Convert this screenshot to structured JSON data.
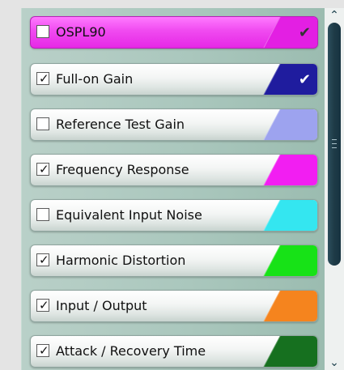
{
  "test_list": {
    "items": [
      {
        "label": "OSPL90",
        "checked": false,
        "selected": true,
        "color": "#e31fe3",
        "swatch_check": true
      },
      {
        "label": "Full-on Gain",
        "checked": true,
        "selected": false,
        "color": "#1f1c9e",
        "swatch_check": true
      },
      {
        "label": "Reference Test Gain",
        "checked": false,
        "selected": false,
        "color": "#9da3ef",
        "swatch_check": false
      },
      {
        "label": "Frequency Response",
        "checked": true,
        "selected": false,
        "color": "#f21ef2",
        "swatch_check": false
      },
      {
        "label": "Equivalent Input Noise",
        "checked": false,
        "selected": false,
        "color": "#34e6f0",
        "swatch_check": false
      },
      {
        "label": "Harmonic Distortion",
        "checked": true,
        "selected": false,
        "color": "#17e217",
        "swatch_check": false
      },
      {
        "label": "Input / Output",
        "checked": true,
        "selected": false,
        "color": "#f5841e",
        "swatch_check": false
      },
      {
        "label": "Attack / Recovery Time",
        "checked": true,
        "selected": false,
        "color": "#16701f",
        "swatch_check": false
      }
    ]
  },
  "scrollbar": {
    "up_icon": "scroll-up-arrow-icon",
    "down_icon": "scroll-down-arrow-icon"
  }
}
